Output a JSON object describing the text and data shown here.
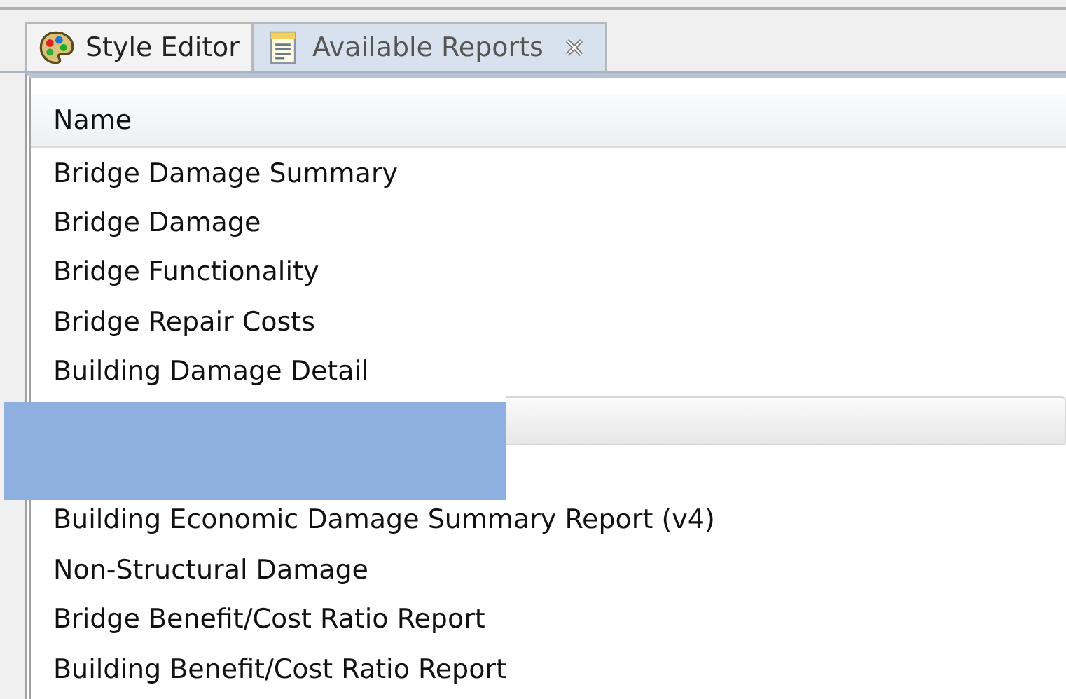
{
  "tabs": [
    {
      "label": "Style Editor",
      "kind": "palette",
      "selected": false,
      "closable": false
    },
    {
      "label": "Available Reports",
      "kind": "report",
      "selected": true,
      "closable": true
    }
  ],
  "table": {
    "columns": [
      "Name"
    ],
    "rows": [
      {
        "name": "Bridge Damage Summary",
        "selected": false
      },
      {
        "name": "Bridge Damage",
        "selected": false
      },
      {
        "name": "Bridge Functionality",
        "selected": false
      },
      {
        "name": "Bridge Repair Costs",
        "selected": false
      },
      {
        "name": "Building Damage Detail",
        "selected": false
      },
      {
        "selected": true
      },
      {
        "name": "Building Economic Damage Summary Report (v4)",
        "selected": false
      },
      {
        "name": "Non-Structural Damage",
        "selected": false
      },
      {
        "name": "Bridge Benefit/Cost Ratio Report",
        "selected": false
      },
      {
        "name": "Building Benefit/Cost Ratio Report",
        "selected": false
      }
    ]
  }
}
